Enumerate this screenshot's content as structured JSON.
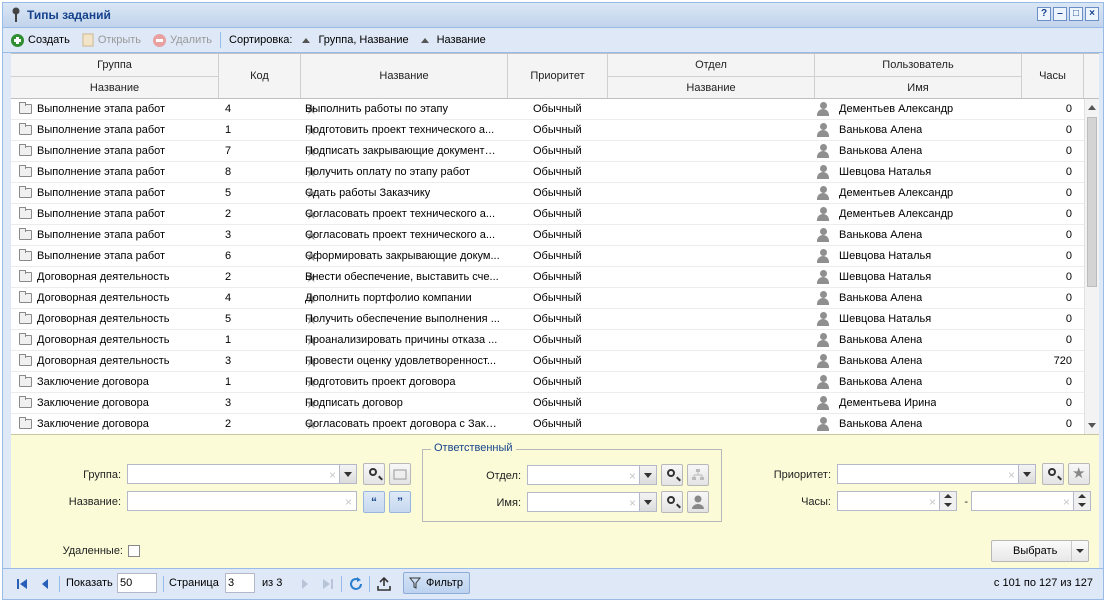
{
  "window": {
    "title": "Типы заданий"
  },
  "toolbar": {
    "create": "Создать",
    "open": "Открыть",
    "delete": "Удалить",
    "sort_label": "Сортировка:",
    "sort1": "Группа, Название",
    "sort2": "Название"
  },
  "columns": {
    "group": "Группа",
    "group_name": "Название",
    "code": "Код",
    "name": "Название",
    "priority": "Приоритет",
    "dept": "Отдел",
    "dept_name": "Название",
    "user": "Пользователь",
    "user_name": "Имя",
    "hours": "Часы"
  },
  "rows": [
    {
      "group": "Выполнение этапа работ",
      "code": "4",
      "name": "Выполнить работы по этапу",
      "priority": "Обычный",
      "dept": "",
      "user": "Дементьев Александр",
      "hours": "0"
    },
    {
      "group": "Выполнение этапа работ",
      "code": "1",
      "name": "Подготовить проект технического а...",
      "priority": "Обычный",
      "dept": "",
      "user": "Ванькова Алена",
      "hours": "0"
    },
    {
      "group": "Выполнение этапа работ",
      "code": "7",
      "name": "Подписать закрывающие документы...",
      "priority": "Обычный",
      "dept": "",
      "user": "Ванькова Алена",
      "hours": "0"
    },
    {
      "group": "Выполнение этапа работ",
      "code": "8",
      "name": "Получить оплату по этапу работ",
      "priority": "Обычный",
      "dept": "",
      "user": "Шевцова Наталья",
      "hours": "0"
    },
    {
      "group": "Выполнение этапа работ",
      "code": "5",
      "name": "Сдать работы Заказчику",
      "priority": "Обычный",
      "dept": "",
      "user": "Дементьев Александр",
      "hours": "0"
    },
    {
      "group": "Выполнение этапа работ",
      "code": "2",
      "name": "Согласовать проект технического а...",
      "priority": "Обычный",
      "dept": "",
      "user": "Дементьев Александр",
      "hours": "0"
    },
    {
      "group": "Выполнение этапа работ",
      "code": "3",
      "name": "Согласовать проект технического а...",
      "priority": "Обычный",
      "dept": "",
      "user": "Ванькова Алена",
      "hours": "0"
    },
    {
      "group": "Выполнение этапа работ",
      "code": "6",
      "name": "Сформировать закрывающие докум...",
      "priority": "Обычный",
      "dept": "",
      "user": "Шевцова Наталья",
      "hours": "0"
    },
    {
      "group": "Договорная деятельность",
      "code": "2",
      "name": "Внести обеспечение, выставить сче...",
      "priority": "Обычный",
      "dept": "",
      "user": "Шевцова Наталья",
      "hours": "0"
    },
    {
      "group": "Договорная деятельность",
      "code": "4",
      "name": "Дополнить портфолио компании",
      "priority": "Обычный",
      "dept": "",
      "user": "Ванькова Алена",
      "hours": "0"
    },
    {
      "group": "Договорная деятельность",
      "code": "5",
      "name": "Получить обеспечение выполнения ...",
      "priority": "Обычный",
      "dept": "",
      "user": "Шевцова Наталья",
      "hours": "0"
    },
    {
      "group": "Договорная деятельность",
      "code": "1",
      "name": "Проанализировать причины отказа ...",
      "priority": "Обычный",
      "dept": "",
      "user": "Ванькова Алена",
      "hours": "0"
    },
    {
      "group": "Договорная деятельность",
      "code": "3",
      "name": "Провести оценку удовлетворенност...",
      "priority": "Обычный",
      "dept": "",
      "user": "Ванькова Алена",
      "hours": "720"
    },
    {
      "group": "Заключение договора",
      "code": "1",
      "name": "Подготовить проект договора",
      "priority": "Обычный",
      "dept": "",
      "user": "Ванькова Алена",
      "hours": "0"
    },
    {
      "group": "Заключение договора",
      "code": "3",
      "name": "Подписать договор",
      "priority": "Обычный",
      "dept": "",
      "user": "Дементьева Ирина",
      "hours": "0"
    },
    {
      "group": "Заключение договора",
      "code": "2",
      "name": "Согласовать проект договора с Зака...",
      "priority": "Обычный",
      "dept": "",
      "user": "Ванькова Алена",
      "hours": "0"
    }
  ],
  "filter": {
    "group_label": "Группа:",
    "name_label": "Название:",
    "responsible_legend": "Ответственный",
    "dept_label": "Отдел:",
    "username_label": "Имя:",
    "priority_label": "Приоритет:",
    "hours_label": "Часы:",
    "hours_dash": "-",
    "deleted_label": "Удаленные:",
    "select_button": "Выбрать",
    "quote_open": "“",
    "quote_close": "”"
  },
  "pager": {
    "show_label": "Показать",
    "page_size": "50",
    "page_label": "Страница",
    "page": "3",
    "of_label": "из 3",
    "filter_button": "Фильтр",
    "summary": "с 101 по 127 из 127"
  },
  "colors": {
    "accent": "#15428b",
    "filter_bg": "#fbfbd8",
    "frame": "#99bbe8"
  }
}
